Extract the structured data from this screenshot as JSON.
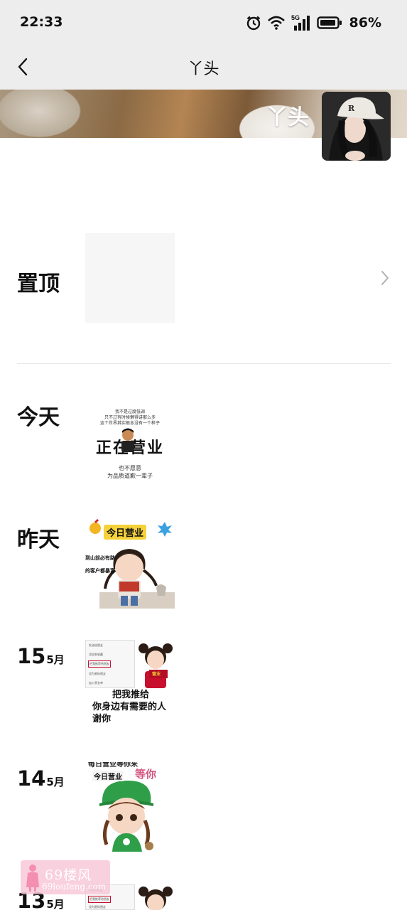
{
  "status_bar": {
    "time": "22:33",
    "network": "5G",
    "battery": "86%"
  },
  "nav": {
    "title": "丫头"
  },
  "profile": {
    "name": "丫头"
  },
  "pinned": {
    "label": "置顶"
  },
  "posts": [
    {
      "date_label": "今天",
      "lines_top": [
        "我不是过度低调",
        "只不过有时候懒得讲那么多",
        "这个世界其实根本没有一个样子"
      ],
      "headline": "正在营业",
      "lines_bottom": [
        "也不愿意",
        "为品质道歉一辈子"
      ]
    },
    {
      "date_label": "昨天",
      "badge": "今日营业",
      "lines": [
        "到山前必有路",
        "的客户都暴富"
      ]
    },
    {
      "day": "15",
      "month": "5月",
      "menu_items": [
        "发送给朋友",
        "添加到收藏",
        "把我推荐给朋友",
        "设为星标朋友",
        "加入黑名单"
      ],
      "lines": [
        "把我推给",
        "你身边有需要的人",
        "谢你"
      ],
      "sign": "营业"
    },
    {
      "day": "14",
      "month": "5月",
      "top_text": "每日营业等你来",
      "badge": "今日营业",
      "badge2": "等你"
    },
    {
      "day": "13",
      "month": "5月",
      "menu_items": [
        "发送给朋友",
        "把我推荐给朋友",
        "设为星标朋友"
      ]
    }
  ],
  "watermark": {
    "text": "69楼风",
    "url": "69loufeng.com"
  },
  "colors": {
    "bar_bg": "#ededed",
    "accent_red": "#c8102e",
    "green": "#2f9e48",
    "watermark_pink": "#f8c4d6"
  }
}
